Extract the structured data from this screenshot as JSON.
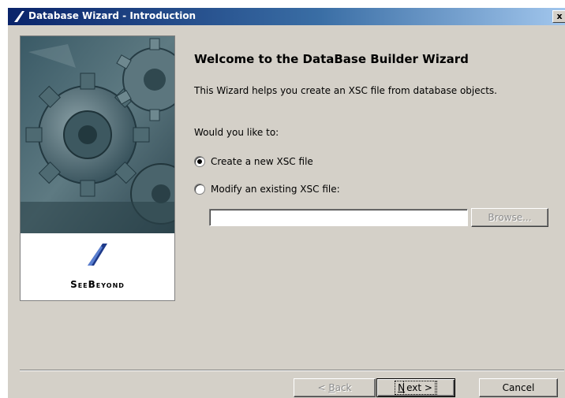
{
  "window": {
    "title": "Database Wizard - Introduction",
    "close_label": "x"
  },
  "side_panel": {
    "brand": "SeeBeyond"
  },
  "content": {
    "title": "Welcome to the DataBase Builder Wizard",
    "description": "This Wizard helps you create an XSC file from database objects.",
    "question": "Would you like to:",
    "options": [
      {
        "label": "Create a new XSC file",
        "selected": true
      },
      {
        "label": "Modify an existing XSC file:",
        "selected": false
      }
    ],
    "file_input_value": "",
    "browse_label": "Browse..."
  },
  "buttons": {
    "back": {
      "prefix": "< ",
      "mnemonic": "B",
      "rest": "ack"
    },
    "next": {
      "mnemonic": "N",
      "rest": "ext >"
    },
    "cancel": "Cancel"
  },
  "colors": {
    "titlebar_start": "#0a246a",
    "titlebar_end": "#a6caf0",
    "dialog_bg": "#d4d0c8"
  },
  "icons": [
    "seebeyond-logo-icon",
    "close-icon",
    "gears-image"
  ]
}
